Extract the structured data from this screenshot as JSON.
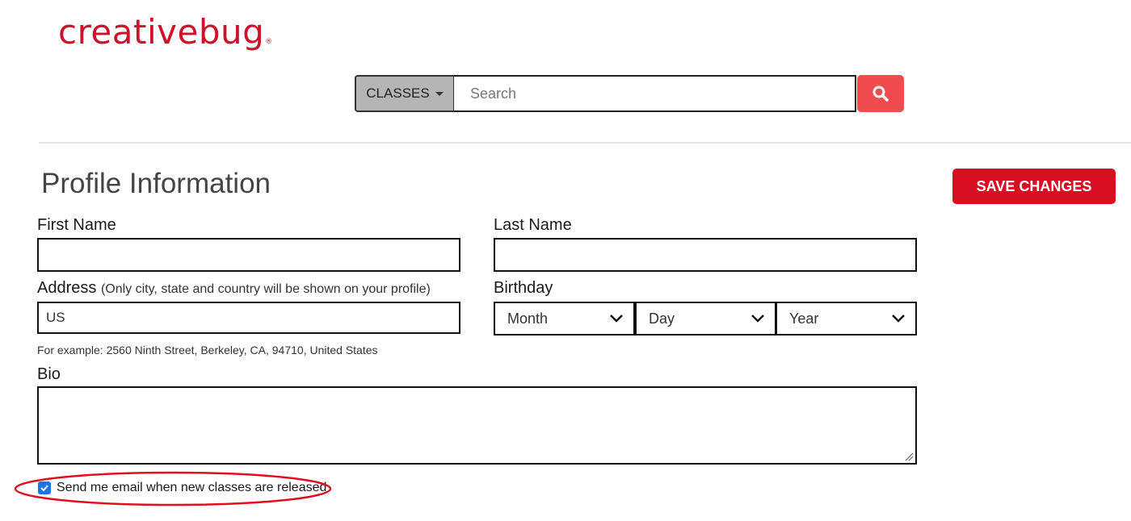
{
  "brand": {
    "logo_text": "creativebug",
    "trademark": "®",
    "color": "#d0112b"
  },
  "search": {
    "category_button_label": "CLASSES",
    "placeholder": "Search",
    "value": "",
    "search_button_icon": "search-icon"
  },
  "profile": {
    "title": "Profile Information",
    "save_button_label": "SAVE CHANGES",
    "first_name": {
      "label": "First Name",
      "value": ""
    },
    "last_name": {
      "label": "Last Name",
      "value": ""
    },
    "address": {
      "label": "Address",
      "hint": "(Only city, state and country will be shown on your profile)",
      "value": "US",
      "example": "For example: 2560 Ninth Street, Berkeley, CA, 94710, United States"
    },
    "birthday": {
      "label": "Birthday",
      "month": "Month",
      "day": "Day",
      "year": "Year"
    },
    "bio": {
      "label": "Bio",
      "value": ""
    },
    "email_opt_in": {
      "label": "Send me email when new classes are released",
      "checked": true
    }
  },
  "colors": {
    "accent": "#d80f22",
    "search_button": "#f04b4e",
    "checkbox": "#1a73e8",
    "highlight": "#e0101e"
  }
}
